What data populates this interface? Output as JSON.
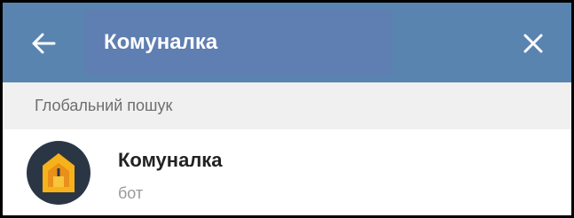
{
  "header": {
    "back_icon": "arrow-left-icon",
    "search_value": "Комуналка",
    "close_icon": "close-icon",
    "bar_color": "#5a84b0",
    "field_color": "#5f7eb1"
  },
  "section": {
    "title": "Глобальний пошук"
  },
  "results": [
    {
      "name": "Комуналка",
      "subtitle": "бот",
      "avatar_icon": "house-logo-icon"
    }
  ]
}
